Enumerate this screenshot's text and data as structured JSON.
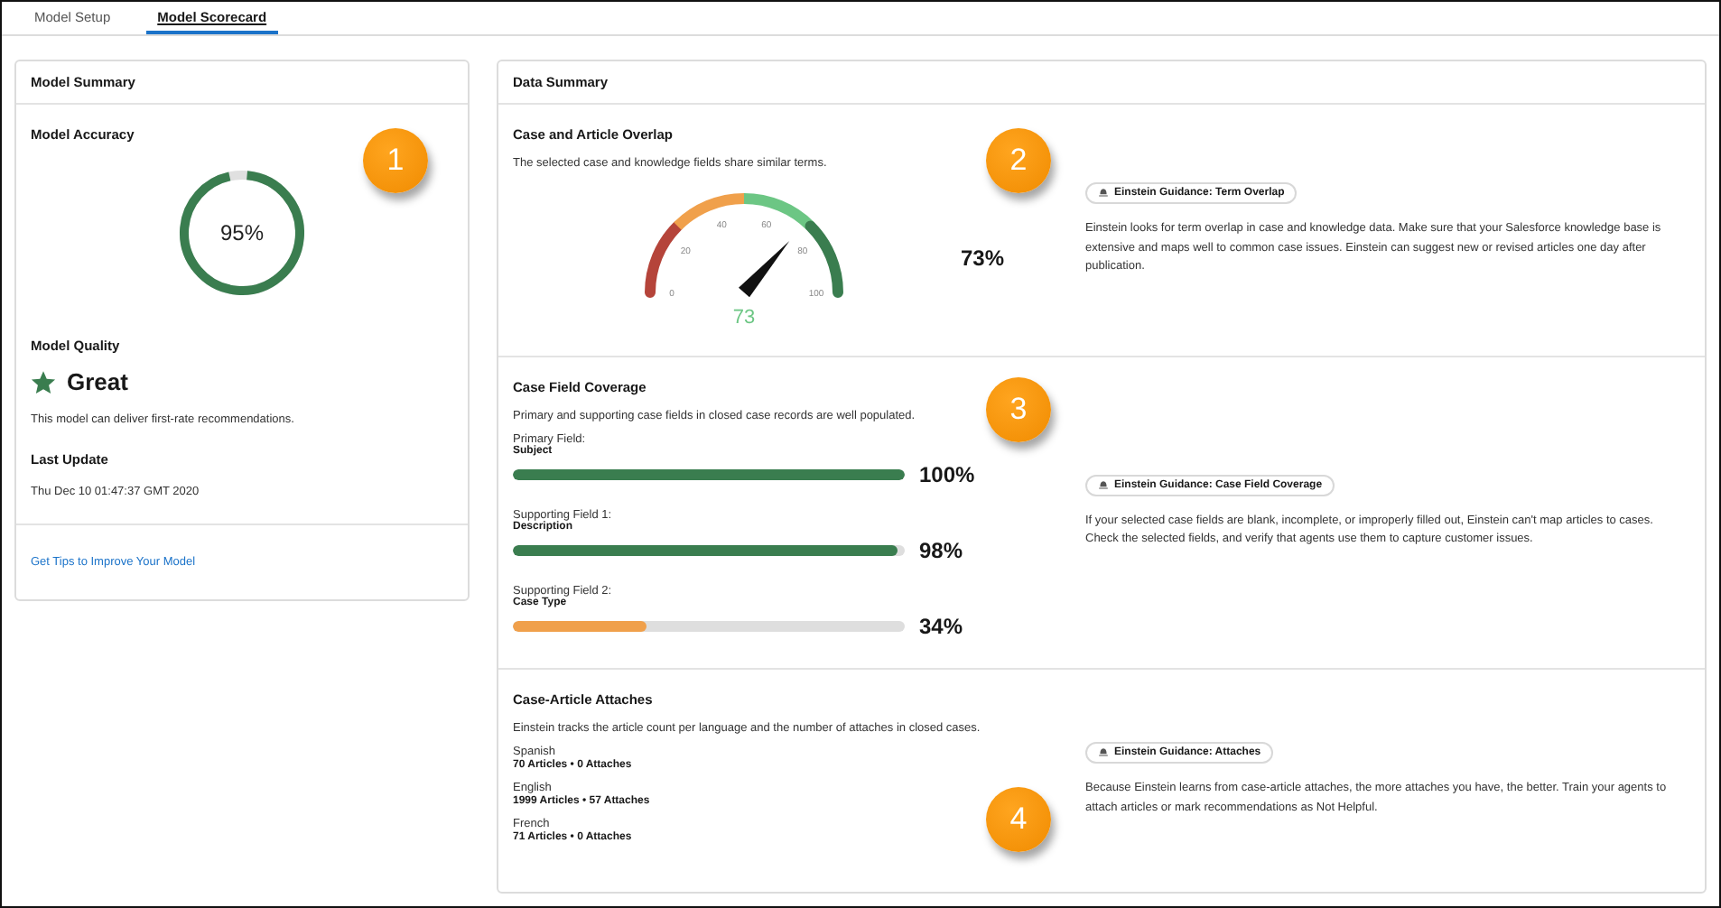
{
  "tabs": [
    {
      "label": "Model Setup",
      "selected": false
    },
    {
      "label": "Model Scorecard",
      "selected": true
    }
  ],
  "model_summary": {
    "title": "Model Summary",
    "accuracy_label": "Model Accuracy",
    "accuracy": {
      "level": 0.95,
      "reading": "95%"
    },
    "quality_label": "Model Quality",
    "quality": "Great",
    "quality_note": "This model can deliver first-rate recommendations.",
    "update_label": "Last Update",
    "update_value": "Thu Dec 10 01:47:37 GMT 2020",
    "link": "Get Tips to Improve Your Model"
  },
  "data_summary": {
    "title": "Data Summary",
    "overlap": {
      "title": "Case and Article Overlap",
      "description": "The selected case and knowledge fields share similar terms.",
      "gauge": {
        "ticks": [
          "0",
          "20",
          "40",
          "60",
          "80",
          "100"
        ],
        "value": "73"
      },
      "reading": "73%",
      "guidance": "Einstein Guidance: Term Overlap",
      "guidance_text": "Einstein looks for term overlap in case and knowledge data. Make sure that your Salesforce knowledge base is extensive and maps well to common case issues. Einstein can suggest new or revised articles one day after publication."
    },
    "coverage": {
      "title": "Case Field Coverage",
      "description": "Primary and supporting case fields in closed case records are well populated.",
      "fields": [
        {
          "label": "Primary Field:",
          "name": "Subject",
          "level": 1.0,
          "reading": "100%",
          "color": "#3a7d4f"
        },
        {
          "label": "Supporting Field 1:",
          "name": "Description",
          "level": 0.98,
          "reading": "98%",
          "color": "#3a7d4f"
        },
        {
          "label": "Supporting Field 2:",
          "name": "Case Type",
          "level": 0.34,
          "reading": "34%",
          "color": "#f0a04b"
        }
      ],
      "guidance": "Einstein Guidance: Case Field Coverage",
      "guidance_text": "If your selected case fields are blank, incomplete, or improperly filled out, Einstein can't map articles to cases. Check the selected fields, and verify that agents use them to capture customer issues."
    },
    "attaches": {
      "title": "Case-Article Attaches",
      "description": "Einstein tracks the article count per language and the number of attaches in closed cases.",
      "languages": [
        {
          "name": "Spanish",
          "counts": "70 Articles • 0 Attaches"
        },
        {
          "name": "English",
          "counts": "1999 Articles • 57 Attaches"
        },
        {
          "name": "French",
          "counts": "71 Articles • 0 Attaches"
        }
      ],
      "guidance": "Einstein Guidance: Attaches",
      "guidance_text": "Because Einstein learns from case-article attaches, the more attaches you have, the better. Train your agents to attach articles or mark recommendations as Not Helpful."
    }
  },
  "callouts": [
    "1",
    "2",
    "3",
    "4"
  ]
}
